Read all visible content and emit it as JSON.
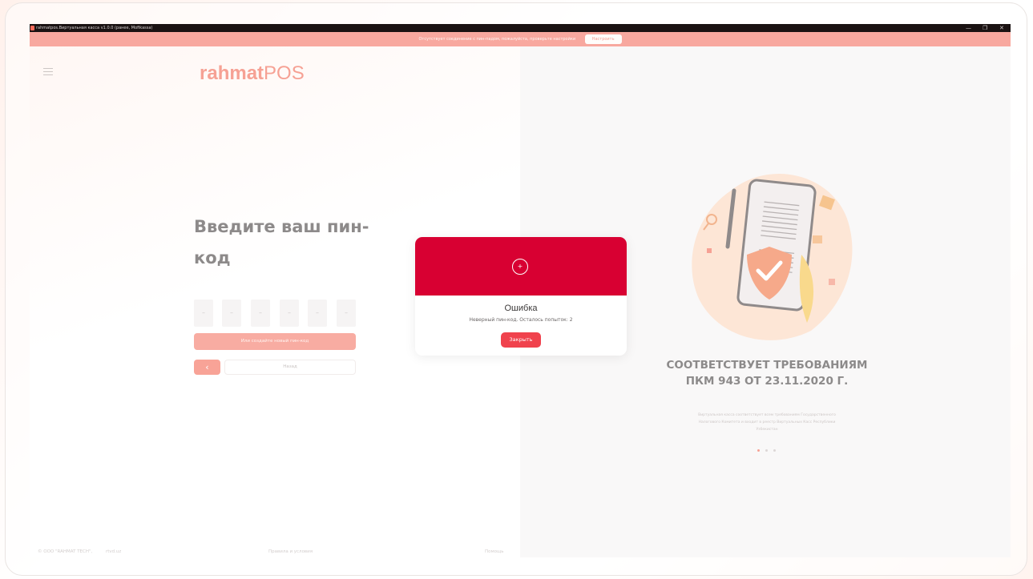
{
  "window": {
    "title": "rahmatpos.Виртуальная касса v1.0.0 (ранее, Mofikassa)",
    "controls": {
      "minimize": "—",
      "maximize": "❐",
      "close": "✕"
    }
  },
  "notification": {
    "message": "Отсутствует соединение с пин-падом, пожалуйста, проверьте настройки",
    "button_label": "Настроить"
  },
  "logo": {
    "bold": "rahmat",
    "light": "POS"
  },
  "pin": {
    "title": "Введите ваш пин-код",
    "boxes": [
      "–",
      "–",
      "–",
      "–",
      "–",
      "–"
    ],
    "create_label": "Или создайте новый пин-код",
    "back_arrow": "‹",
    "back_label": "Назад"
  },
  "footer": {
    "copyright": "© ООО \"RAHMAT TECH\",",
    "site": "rtvd.uz",
    "terms": "Правила и условия",
    "help": "Помощь"
  },
  "promo": {
    "title": "СООТВЕТСТВУЕТ ТРЕБОВАНИЯМ ПКМ 943 ОТ 23.11.2020 Г.",
    "description": "Виртуальная касса соответствует всем требованиям Государственного Налогового Комитета и входит в реестр Виртуальных Касс Республики Узбекистан",
    "slides": 3,
    "active_slide": 1
  },
  "modal": {
    "icon": "+",
    "title": "Ошибка",
    "message": "Неверный пин-код. Осталось попыток: 2",
    "close_label": "Закрыть"
  },
  "colors": {
    "accent": "#f8a89f",
    "error_header": "#d80032",
    "close_button": "#f0424d",
    "dot_active": "#f6a194",
    "dot_inactive": "#dcd7d6"
  }
}
